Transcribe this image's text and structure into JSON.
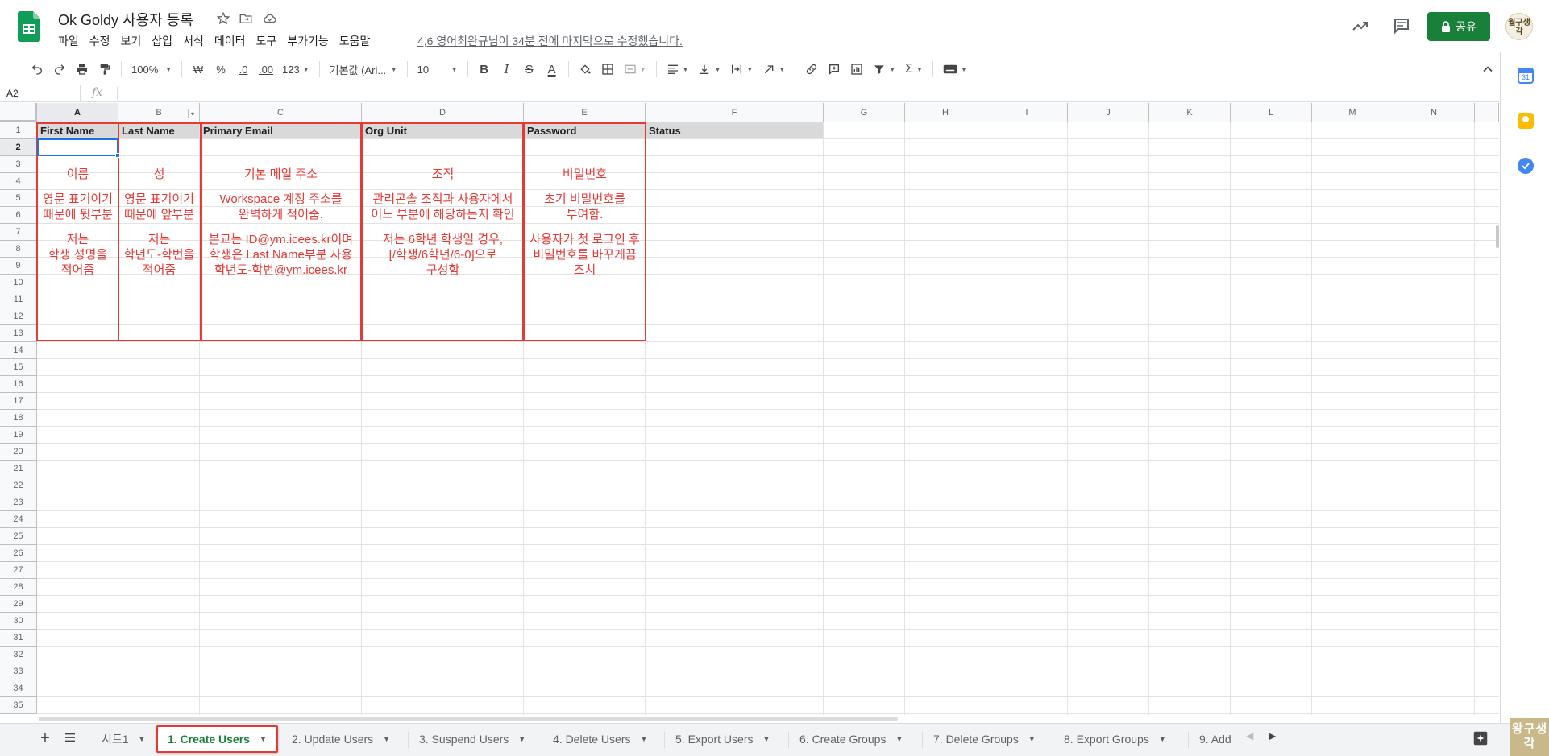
{
  "app": {
    "title": "Ok Goldy 사용자 등록",
    "menu": [
      "파일",
      "수정",
      "보기",
      "삽입",
      "서식",
      "데이터",
      "도구",
      "부가기능",
      "도움말"
    ],
    "last_edit": "4,6 영어최완규님이 34분 전에 마지막으로 수정했습니다.",
    "share_label": "공유",
    "avatar_text": "월구생각"
  },
  "toolbar": {
    "zoom": "100%",
    "currency": "₩",
    "percent": "%",
    "decimal_less": ".0",
    "decimal_more": ".00",
    "number_format": "123",
    "font": "기본값 (Ari...",
    "font_size": "10",
    "bold": "B",
    "italic": "I",
    "strike": "S",
    "text_color": "A"
  },
  "formula_bar": {
    "cell_ref": "A2",
    "fx": "fx",
    "value": ""
  },
  "grid": {
    "columns": [
      "A",
      "B",
      "C",
      "D",
      "E",
      "F",
      "G",
      "H",
      "I",
      "J",
      "K",
      "L",
      "M",
      "N"
    ],
    "rows": [
      "1",
      "2",
      "3",
      "4",
      "5",
      "6",
      "7",
      "8",
      "9",
      "10",
      "11",
      "12",
      "13",
      "14",
      "15",
      "16",
      "17",
      "18",
      "19",
      "20",
      "21",
      "22",
      "23",
      "24",
      "25",
      "26",
      "27",
      "28",
      "29",
      "30",
      "31",
      "32",
      "33",
      "34",
      "35"
    ],
    "header_cells": [
      "First Name",
      "Last Name",
      "Primary Email",
      "Org Unit",
      "Password",
      "Status"
    ]
  },
  "notes": {
    "first_name": [
      "이름",
      "",
      "영문 표기이기",
      "때문에 뒷부분",
      "",
      "저는",
      "학생 성명을",
      "적어줌"
    ],
    "last_name": [
      "성",
      "",
      "영문 표기이기",
      "때문에 앞부분",
      "",
      "저는",
      "학년도-학번을",
      "적어줌"
    ],
    "email": [
      "기본 메일 주소",
      "",
      "Workspace 계정 주소를",
      "완벽하게 적어줌.",
      "",
      "본교는 ID@ym.icees.kr이며",
      "학생은 Last Name부분 사용",
      "학년도-학번@ym.icees.kr"
    ],
    "org_unit": [
      "조직",
      "",
      "관리콘솔 조직과 사용자에서",
      "어느 부분에 해당하는지 확인",
      "",
      "저는 6학년 학생일 경우,",
      "[/학생/6학년/6-0]으로",
      "구성함"
    ],
    "password": [
      "비밀번호",
      "",
      "초기 비밀번호를",
      "부여함.",
      "",
      "사용자가 첫 로그인 후",
      "비밀번호를 바꾸게끔",
      "조치"
    ]
  },
  "sheets": [
    {
      "label": "시트1"
    },
    {
      "label": "1. Create Users",
      "active": true
    },
    {
      "label": "2. Update Users"
    },
    {
      "label": "3. Suspend Users"
    },
    {
      "label": "4. Delete Users"
    },
    {
      "label": "5. Export Users"
    },
    {
      "label": "6. Create Groups"
    },
    {
      "label": "7. Delete Groups"
    },
    {
      "label": "8. Export Groups"
    },
    {
      "label": "9. Add"
    }
  ],
  "watermark": "왕구생각",
  "colors": {
    "brand_green": "#188038",
    "annotation_red": "#e53935",
    "selection_blue": "#1a73e8",
    "header_fill": "#d9d9d9"
  },
  "icons": {
    "app_logo": "sheets-logo-icon",
    "star": "star-icon",
    "move": "folder-move-icon",
    "cloud": "cloud-status-icon",
    "trend": "trend-icon",
    "comment": "comment-icon",
    "lock": "lock-icon"
  }
}
